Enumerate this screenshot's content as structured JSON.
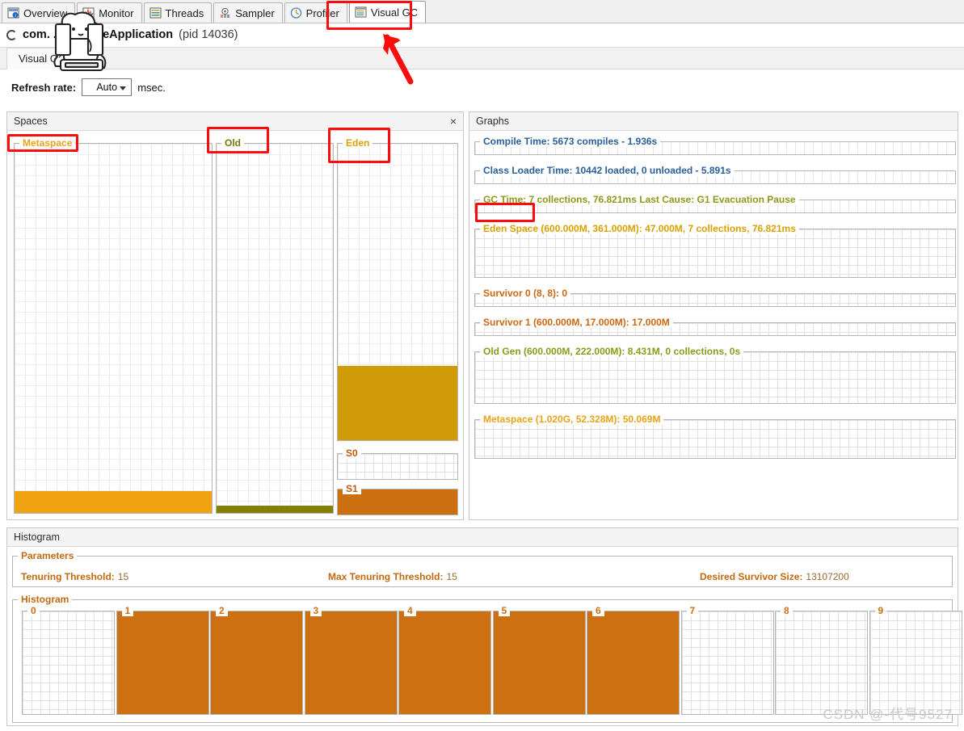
{
  "window": {
    "tabs": [
      {
        "label": "Overview",
        "icon": "overview-icon",
        "selected": false
      },
      {
        "label": "Monitor",
        "icon": "monitor-icon",
        "selected": false
      },
      {
        "label": "Threads",
        "icon": "threads-icon",
        "selected": false
      },
      {
        "label": "Sampler",
        "icon": "sampler-icon",
        "selected": false
      },
      {
        "label": "Profiler",
        "icon": "profiler-icon",
        "selected": false
      },
      {
        "label": "Visual GC",
        "icon": "visualgc-icon",
        "selected": true
      }
    ],
    "app_title": "com.    .     OptimizeApplication",
    "app_pid": "(pid 14036)",
    "sub_tab": "Visual GC",
    "refresh_label": "Refresh rate:",
    "refresh_value": "Auto",
    "refresh_unit": "msec."
  },
  "spaces": {
    "panel_title": "Spaces",
    "close_label": "×",
    "columns": [
      {
        "name": "Metaspace",
        "fill_pct": 6,
        "color": "#efa212",
        "label_color": "#e8a317"
      },
      {
        "name": "Old",
        "fill_pct": 2,
        "color": "#847f07",
        "label_color": "#7a7607"
      },
      {
        "name": "Eden",
        "fill_pct": 25,
        "color": "#cf9b06",
        "label_color": "#d9a200"
      }
    ],
    "survivors": [
      {
        "name": "S0",
        "fill_pct": 0,
        "color": "#cc6f10",
        "label_color": "#c4590d"
      },
      {
        "name": "S1",
        "fill_pct": 100,
        "color": "#cc6f10",
        "label_color": "#c4590d"
      }
    ]
  },
  "graphs": {
    "panel_title": "Graphs",
    "items": [
      {
        "label": "Compile Time: 5673 compiles - 1.936s",
        "color": "#2a6099",
        "height": 24,
        "grid": "vert"
      },
      {
        "label": "Class Loader Time: 10442 loaded, 0 unloaded - 5.891s",
        "color": "#2a6099",
        "height": 24,
        "grid": "vert"
      },
      {
        "label": "GC Time: 7 collections, 76.821ms Last Cause: G1 Evacuation Pause",
        "color": "#8c9a1c",
        "height": 24,
        "grid": "vert"
      },
      {
        "label": "Eden Space (600.000M, 361.000M): 47.000M, 7 collections, 76.821ms",
        "color": "#d9a100",
        "height": 68,
        "grid": "fine"
      },
      {
        "label": "Survivor 0 (8, 8): 0",
        "color": "#cc6712",
        "height": 24,
        "grid": "fine"
      },
      {
        "label": "Survivor 1 (600.000M, 17.000M): 17.000M",
        "color": "#cc6712",
        "height": 24,
        "grid": "fine"
      },
      {
        "label": "Old Gen (600.000M, 222.000M): 8.431M, 0 collections, 0s",
        "color": "#8c9a1c",
        "height": 72,
        "grid": "fine"
      },
      {
        "label": "Metaspace (1.020G, 52.328M): 50.069M",
        "color": "#e8a317",
        "height": 56,
        "grid": "fine"
      }
    ]
  },
  "histogram": {
    "panel_title": "Histogram",
    "parameters_label": "Parameters",
    "parameters": [
      {
        "label": "Tenuring Threshold:",
        "value": "15"
      },
      {
        "label": "Max Tenuring Threshold:",
        "value": "15"
      },
      {
        "label": "Desired Survivor Size:",
        "value": "13107200"
      }
    ],
    "histogram_label": "Histogram",
    "chart_data": {
      "type": "bar",
      "title": "Histogram",
      "categories": [
        "0",
        "1",
        "2",
        "3",
        "4",
        "5",
        "6",
        "7",
        "8",
        "9"
      ],
      "values": [
        0,
        100,
        100,
        100,
        100,
        100,
        100,
        0,
        0,
        0
      ],
      "xlabel": "",
      "ylabel": "",
      "ylim": [
        0,
        100
      ],
      "bar_color": "#cc7012",
      "grid": true,
      "legend": "none"
    }
  },
  "annotations": {
    "watermark": "CSDN @-代号9527",
    "boxes": [
      {
        "name": "visual-gc-tab-highlight"
      },
      {
        "name": "metaspace-label-highlight"
      },
      {
        "name": "old-label-highlight"
      },
      {
        "name": "eden-label-highlight"
      },
      {
        "name": "gc-time-highlight"
      }
    ],
    "arrow": {
      "name": "pointer-arrow",
      "color": "#fb0d0d"
    }
  }
}
